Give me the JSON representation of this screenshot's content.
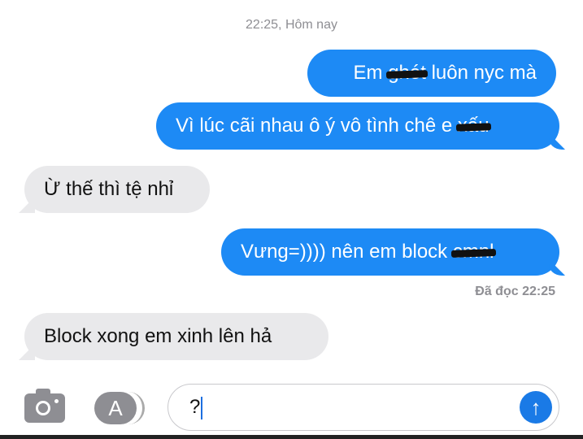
{
  "timestamp": "22:25, Hôm nay",
  "messages": [
    {
      "dir": "out",
      "before": "Em ",
      "censored": "ghét",
      "after": " luôn nyc mà"
    },
    {
      "dir": "out",
      "before": "Vì lúc cãi nhau ô ý vô tình chê e ",
      "censored": "xấu",
      "after": ""
    },
    {
      "dir": "in",
      "text": "Ừ thế thì tệ nhỉ"
    },
    {
      "dir": "out",
      "before": "Vưng=)))) nên em block ",
      "censored": "cmnl",
      "after": ""
    },
    {
      "dir": "in",
      "text": "Block xong em xinh lên hả"
    }
  ],
  "read_receipt": "Đã đọc 22:25",
  "input": {
    "value": "?"
  },
  "icons": {
    "camera": "camera-icon",
    "appstore": "app-store-icon",
    "send": "send-arrow-up-icon"
  },
  "colors": {
    "outgoing": "#1d8af5",
    "incoming": "#e9e9eb"
  }
}
